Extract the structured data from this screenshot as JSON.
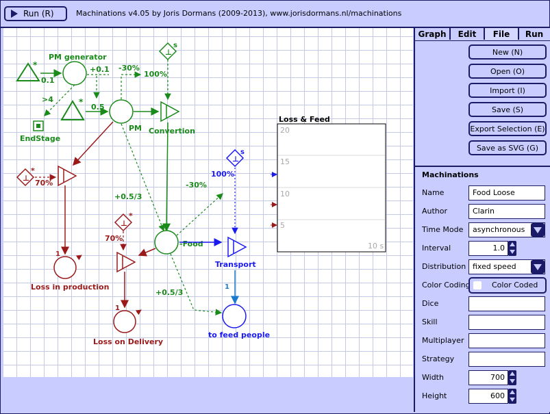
{
  "topbar": {
    "run_label": "Run (R)",
    "title": "Machinations v4.05 by Joris Dormans (2009-2013), www.jorisdormans.nl/machinations"
  },
  "tabs": [
    "Graph",
    "Edit",
    "File",
    "Run"
  ],
  "active_tab": "File",
  "file_buttons": [
    "New (N)",
    "Open (O)",
    "Import (I)",
    "Save (S)",
    "Export Selection (E)",
    "Save as SVG (G)"
  ],
  "properties": {
    "section_title": "Machinations",
    "name_label": "Name",
    "name_value": "Food Loose",
    "author_label": "Author",
    "author_value": "Clarin",
    "time_mode_label": "Time Mode",
    "time_mode_value": "asynchronous",
    "interval_label": "Interval",
    "interval_value": "1.0",
    "distribution_label": "Distribution",
    "distribution_value": "fixed speed",
    "color_coding_label": "Color Coding",
    "color_coding_value": "Color Coded",
    "dice_label": "Dice",
    "dice_value": "",
    "skill_label": "Skill",
    "skill_value": "",
    "multiplayer_label": "Multiplayer",
    "multiplayer_value": "",
    "strategy_label": "Strategy",
    "strategy_value": "",
    "width_label": "Width",
    "width_value": "700",
    "height_label": "Height",
    "height_value": "600"
  },
  "diagram": {
    "labels": {
      "pm_generator": "PM generator",
      "end_stage": "EndStage",
      "pm": "PM",
      "convertion": "Convertion",
      "food": "-Food",
      "transport": "Transport",
      "to_feed_people": "to feed people",
      "loss_in_production": "Loss in production",
      "loss_on_delivery": "Loss on Delivery"
    },
    "values": {
      "v_0_1_a": "0.1",
      "v_plus_0_1": "+0.1",
      "v_minus_30_a": "-30%",
      "v_100_a": "100%",
      "v_gt4": ">4",
      "v_0_5": "0.5",
      "v_70_a": "70%",
      "v_plus_05_3_a": "+0.5/3",
      "v_minus_30_b": "-30%",
      "v_100_b": "100%",
      "v_70_b": "70%",
      "v_1_a": "1",
      "v_1_b": "1",
      "v_1_c": "1",
      "v_plus_05_3_b": "+0.5/3",
      "s_a": "s",
      "s_b": "s"
    },
    "chart": {
      "title": "Loss & Feed",
      "ticks": [
        "20",
        "15",
        "10",
        "5"
      ],
      "time_label": "10 s"
    }
  },
  "colors": {
    "green": "#1a8a1a",
    "dark_red": "#9a1a1a",
    "blue": "#1a1aee",
    "navy": "#1a1a66",
    "panel_bg": "#c8ccff"
  }
}
